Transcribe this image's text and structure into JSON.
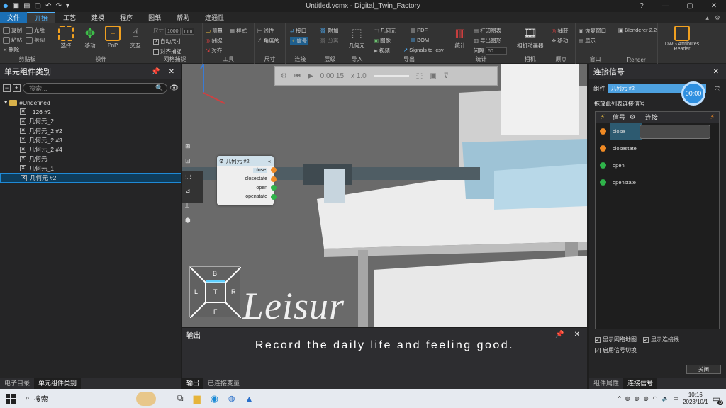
{
  "window": {
    "title": "Untitled.vcmx - Digital_Twin_Factory"
  },
  "menu_tabs": [
    "文件",
    "开始",
    "工艺",
    "建模",
    "程序",
    "图纸",
    "帮助",
    "连通性"
  ],
  "ribbon": {
    "clipboard": {
      "label": "剪贴板",
      "copy": "复制",
      "paste": "粘贴",
      "cut": "剪切",
      "delete": "删除",
      "clone": "克隆"
    },
    "operation": {
      "label": "操作",
      "select": "选择",
      "move": "移动",
      "pnp": "PnP",
      "interact": "交互"
    },
    "grid": {
      "label": "网格捕捉",
      "size_label": "尺寸",
      "size_value": "1000",
      "unit": "mm",
      "auto_size": "自动尺寸",
      "snap_grid": "对齐捕捉"
    },
    "tools": {
      "label": "工具",
      "measure": "测量",
      "style": "样式",
      "snap": "捕捉",
      "align": "对齐"
    },
    "dimension": {
      "label": "尺寸",
      "linear": "线性",
      "angle": "角度的"
    },
    "connect": {
      "label": "连接",
      "interface": "接口",
      "signal": "信号"
    },
    "hierarchy": {
      "label": "层级",
      "attach": "附加",
      "detach": "分离"
    },
    "import": {
      "label": "导入",
      "geometry": "几何元"
    },
    "export": {
      "label": "导出",
      "geometry": "几何元",
      "image": "图像",
      "video": "视频",
      "pdf": "PDF",
      "bom": "BOM",
      "signals_csv": "Signals to .csv"
    },
    "stats": {
      "label": "统计",
      "stats": "统计",
      "print": "打印图表",
      "export_chart": "导出图形",
      "interval_label": "间隔",
      "interval_value": "60"
    },
    "camera": {
      "label": "相机",
      "animate": "相机动画器"
    },
    "origin": {
      "label": "原点",
      "capture": "捕获",
      "move": "移动"
    },
    "window": {
      "label": "窗口",
      "restore": "恢复窗口",
      "show": "显示"
    },
    "render": {
      "label": "Render",
      "blender": "Blenderer 2.2"
    },
    "dwg": {
      "label": "DWG Attributes Reader"
    }
  },
  "left_panel": {
    "title": "单元组件类别",
    "search_placeholder": "搜索...",
    "tree": [
      {
        "label": "#Undefined",
        "indent": 0,
        "folder": true
      },
      {
        "label": "_126 #2",
        "indent": 1
      },
      {
        "label": "几何元_2",
        "indent": 1
      },
      {
        "label": "几何元_2 #2",
        "indent": 1
      },
      {
        "label": "几何元_2 #3",
        "indent": 1
      },
      {
        "label": "几何元_2 #4",
        "indent": 1
      },
      {
        "label": "几何元",
        "indent": 1
      },
      {
        "label": "几何元_1",
        "indent": 1
      },
      {
        "label": "几何元 #2",
        "indent": 1,
        "selected": true
      }
    ],
    "bottom_tabs": [
      "电子目录",
      "单元组件类别"
    ]
  },
  "viewport": {
    "time": "0:00:15",
    "speed": "x 1.0",
    "watermark": "Leisur",
    "cube": {
      "top": "B",
      "left": "L",
      "center": "T",
      "right": "R",
      "bottom": "F"
    },
    "signal_card": {
      "title": "几何元 #2",
      "signals": [
        {
          "name": "close",
          "color": "#f08a24"
        },
        {
          "name": "closestate",
          "color": "#f08a24"
        },
        {
          "name": "open",
          "color": "#2fb34a"
        },
        {
          "name": "openstate",
          "color": "#2fb34a"
        }
      ]
    }
  },
  "output": {
    "title": "输出",
    "subtitle": "Record the daily life and feeling good.",
    "tabs": [
      "输出",
      "已连接变量"
    ]
  },
  "right_panel": {
    "title": "连接信号",
    "component_label": "组件",
    "component_value": "几何元 #2",
    "timer": "00:00",
    "drag_text": "拖放此列表连接信号",
    "col_signal": "信号",
    "col_connect": "连接",
    "rows": [
      {
        "name": "close",
        "color": "#f08a24"
      },
      {
        "name": "closestate",
        "color": "#f08a24"
      },
      {
        "name": "open",
        "color": "#2fb34a"
      },
      {
        "name": "openstate",
        "color": "#2fb34a"
      }
    ],
    "opt_show_network": "显示网络地图",
    "opt_show_hint": "显示连接线",
    "opt_enable_switch": "启用信号切换",
    "close_button": "关闭",
    "bottom_tabs": [
      "组件属性",
      "连接信号"
    ]
  },
  "taskbar": {
    "search": "搜索",
    "time": "10:16",
    "date": "2023/10/1",
    "notify_count": "3"
  }
}
